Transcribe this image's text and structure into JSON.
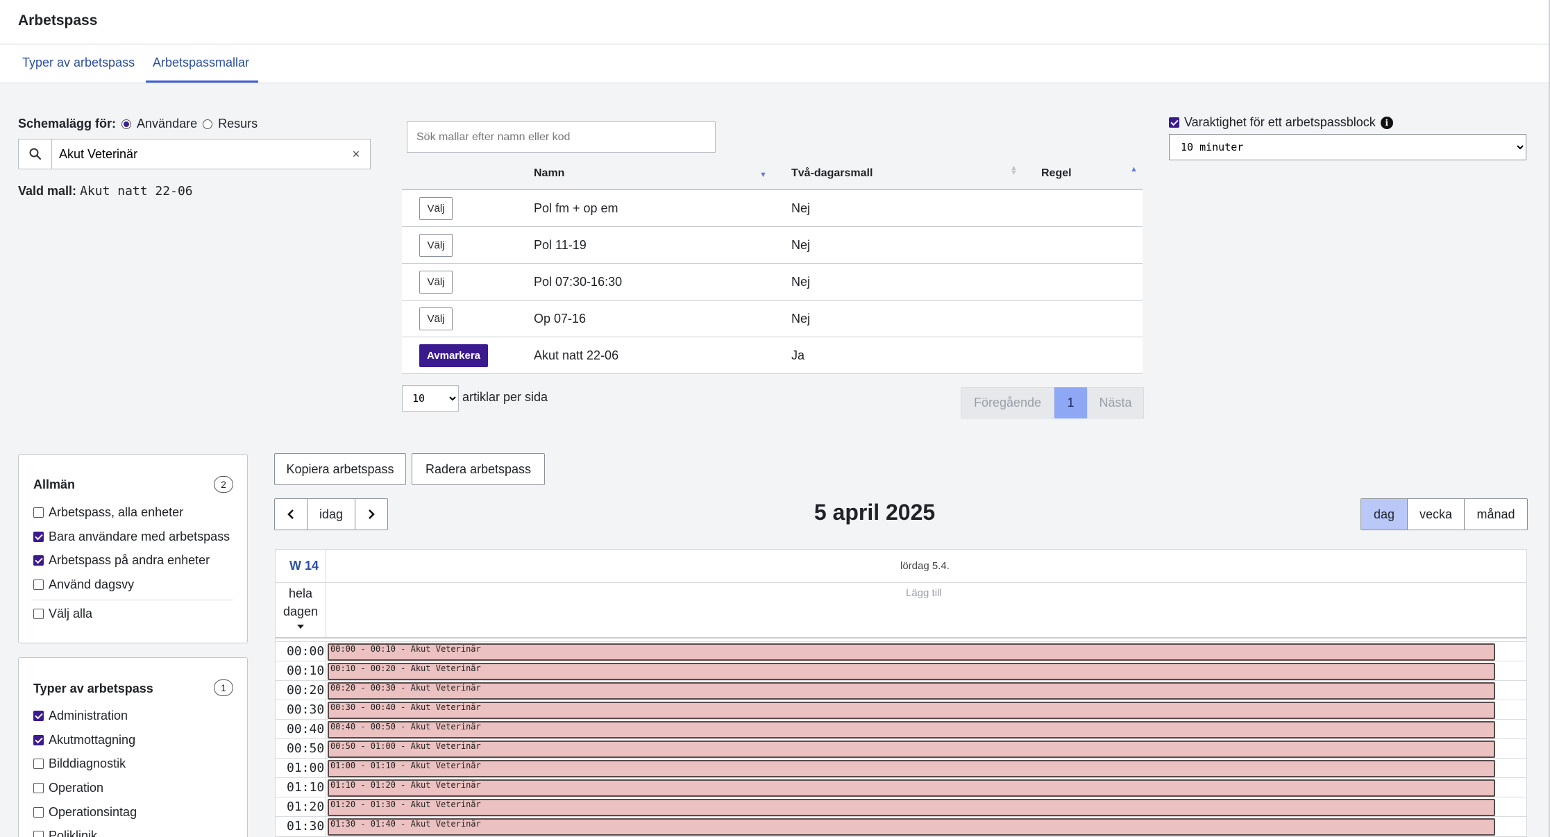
{
  "header": {
    "title": "Arbetspass"
  },
  "tabs": [
    {
      "label": "Typer av arbetspass",
      "active": false
    },
    {
      "label": "Arbetspassmallar",
      "active": true
    }
  ],
  "schedule": {
    "label": "Schemalägg för:",
    "options": [
      "Användare",
      "Resurs"
    ],
    "selected": "Användare",
    "search_value": "Akut Veterinär",
    "clear": "×",
    "chosen_label": "Vald mall:",
    "chosen_value": "Akut natt 22-06"
  },
  "templates": {
    "search_placeholder": "Sök mallar efter namn eller kod",
    "columns": [
      "Namn",
      "Två-dagarsmall",
      "Regel"
    ],
    "rows": [
      {
        "action": "Välj",
        "name": "Pol fm + op em",
        "twoday": "Nej",
        "rule": ""
      },
      {
        "action": "Välj",
        "name": "Pol 11-19",
        "twoday": "Nej",
        "rule": ""
      },
      {
        "action": "Välj",
        "name": "Pol 07:30-16:30",
        "twoday": "Nej",
        "rule": ""
      },
      {
        "action": "Välj",
        "name": "Op 07-16",
        "twoday": "Nej",
        "rule": ""
      },
      {
        "action": "Avmarkera",
        "name": "Akut natt 22-06",
        "twoday": "Ja",
        "rule": ""
      }
    ],
    "per_page_value": "10",
    "per_page_label": "artiklar per sida",
    "pager": {
      "prev": "Föregående",
      "current": "1",
      "next": "Nästa"
    }
  },
  "duration": {
    "label": "Varaktighet för ett arbetspassblock",
    "checked": true,
    "value": "10 minuter"
  },
  "filters": {
    "general": {
      "title": "Allmän",
      "badge": "2",
      "items": [
        {
          "label": "Arbetspass, alla enheter",
          "checked": false
        },
        {
          "label": "Bara användare med arbetspass",
          "checked": true
        },
        {
          "label": "Arbetspass på andra enheter",
          "checked": true
        },
        {
          "label": "Använd dagsvy",
          "checked": false
        }
      ],
      "select_all": "Välj alla"
    },
    "types": {
      "title": "Typer av arbetspass",
      "badge": "1",
      "items": [
        {
          "label": "Administration",
          "checked": true
        },
        {
          "label": "Akutmottagning",
          "checked": true
        },
        {
          "label": "Bilddiagnostik",
          "checked": false
        },
        {
          "label": "Operation",
          "checked": false
        },
        {
          "label": "Operationsintag",
          "checked": false
        },
        {
          "label": "Poliklinik",
          "checked": false
        }
      ]
    }
  },
  "actions": {
    "copy": "Kopiera arbetspass",
    "delete": "Radera arbetspass"
  },
  "calendar": {
    "today": "idag",
    "title": "5 april 2025",
    "views": [
      "dag",
      "vecka",
      "månad"
    ],
    "active_view": "dag",
    "week": "W 14",
    "day_label": "lördag 5.4.",
    "allday": "hela dagen",
    "add": "Lägg till",
    "slots": [
      {
        "time": "00:00",
        "event": "00:00 - 00:10 - Akut Veterinär"
      },
      {
        "time": "00:10",
        "event": "00:10 - 00:20 - Akut Veterinär"
      },
      {
        "time": "00:20",
        "event": "00:20 - 00:30 - Akut Veterinär"
      },
      {
        "time": "00:30",
        "event": "00:30 - 00:40 - Akut Veterinär"
      },
      {
        "time": "00:40",
        "event": "00:40 - 00:50 - Akut Veterinär"
      },
      {
        "time": "00:50",
        "event": "00:50 - 01:00 - Akut Veterinär"
      },
      {
        "time": "01:00",
        "event": "01:00 - 01:10 - Akut Veterinär"
      },
      {
        "time": "01:10",
        "event": "01:10 - 01:20 - Akut Veterinär"
      },
      {
        "time": "01:20",
        "event": "01:20 - 01:30 - Akut Veterinär"
      },
      {
        "time": "01:30",
        "event": "01:30 - 01:40 - Akut Veterinär"
      }
    ]
  },
  "colors": {
    "primary": "#3b1a8f",
    "link": "#2b4fa0",
    "event": "#ecc1c1",
    "active_page": "#8fa8f5"
  }
}
